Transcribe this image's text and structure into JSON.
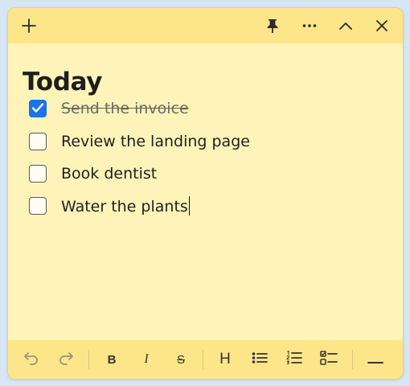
{
  "note": {
    "heading": "Today",
    "todos": [
      {
        "text": "Send the invoice",
        "checked": true
      },
      {
        "text": "Review the landing page",
        "checked": false
      },
      {
        "text": "Book dentist",
        "checked": false
      },
      {
        "text": "Water the plants",
        "checked": false
      }
    ]
  },
  "titlebar": {
    "icons": [
      "plus-icon",
      "pin-icon",
      "more-icon",
      "collapse-icon",
      "close-icon"
    ]
  },
  "toolbar": {
    "bold_label": "B",
    "italic_label": "I",
    "strike_label": "S",
    "heading_label": "H",
    "icons": [
      "undo-icon",
      "redo-icon",
      "bold-icon",
      "italic-icon",
      "strikethrough-icon",
      "heading-icon",
      "bullet-list-icon",
      "numbered-list-icon",
      "checklist-icon",
      "divider-icon"
    ]
  },
  "colors": {
    "note_bg": "#fef4b9",
    "bar_bg": "#fde68a",
    "checkbox_checked": "#1a73e8"
  }
}
